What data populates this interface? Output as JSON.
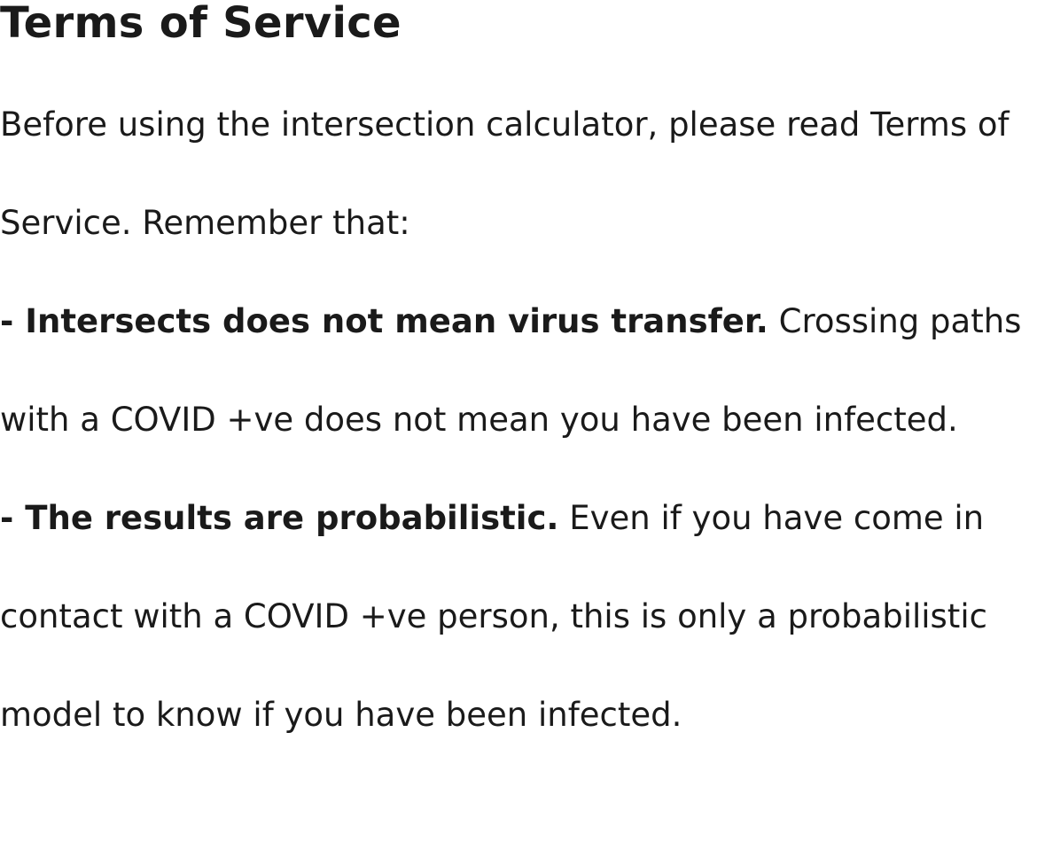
{
  "page": {
    "title": "Terms of Service",
    "intro": "Before using the intersection calculator, please read Terms of Service. Remember that:",
    "points": [
      {
        "bold": "- Intersects does not mean virus transfer.",
        "text": " Crossing paths with a COVID +ve does not mean you have been infected."
      },
      {
        "bold": "- The results are probabilistic.",
        "text": " Even if you have come in contact with a COVID +ve person, this is only a probabilistic model to know if you have been infected."
      }
    ]
  }
}
